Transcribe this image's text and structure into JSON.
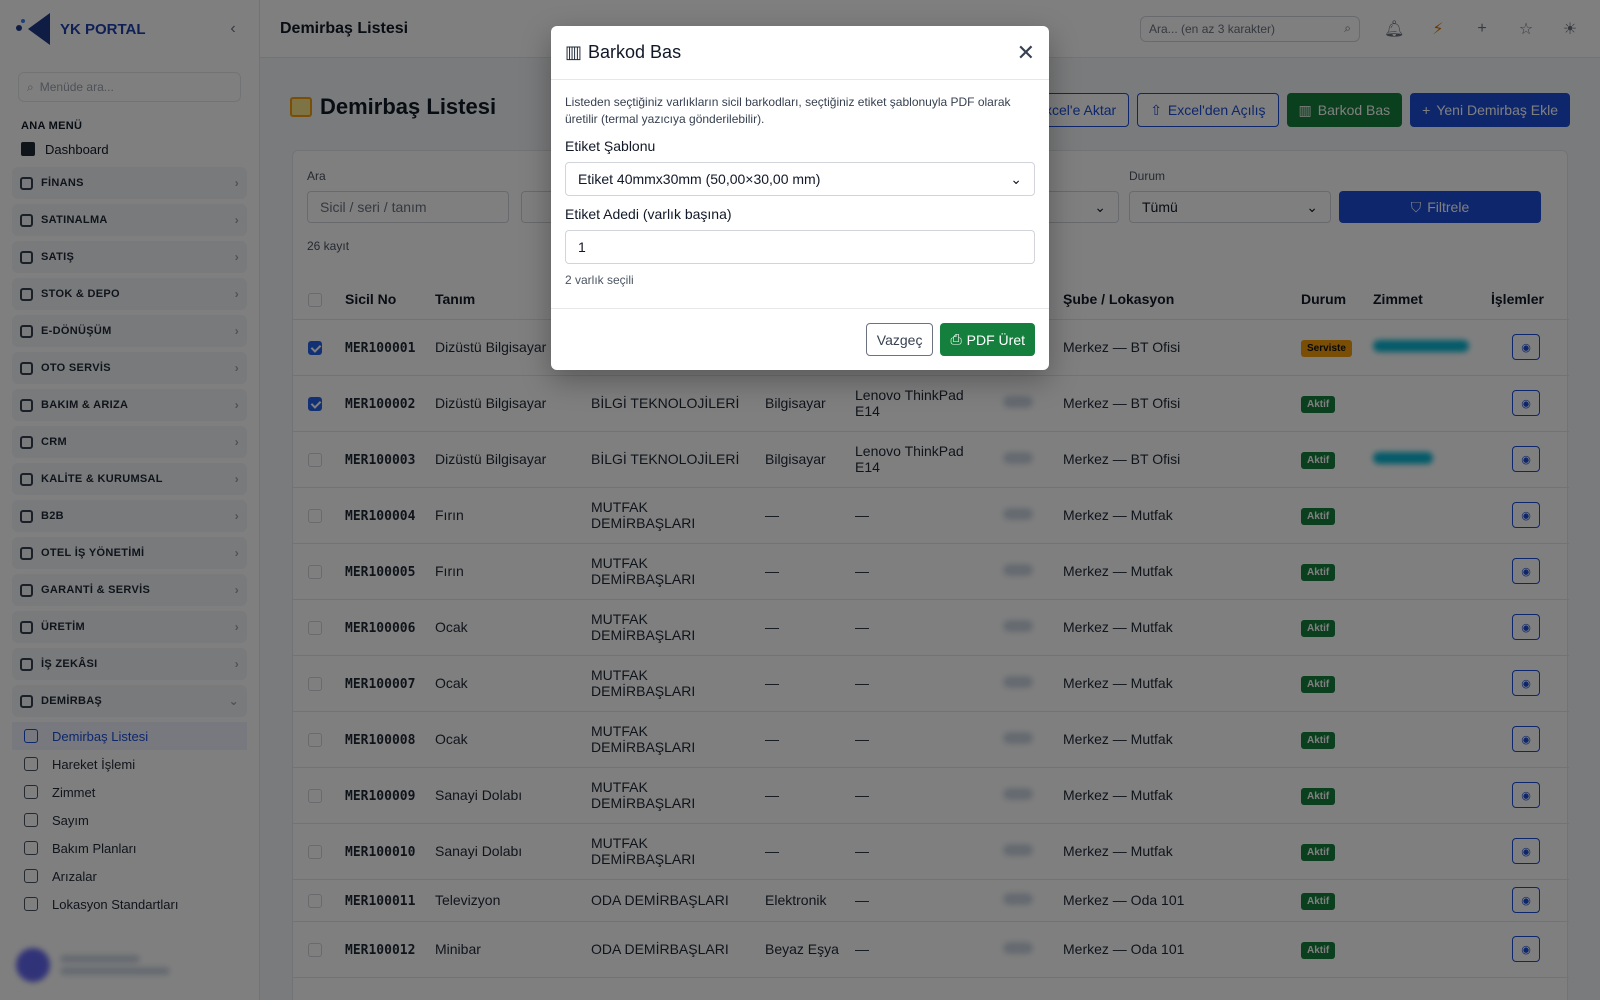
{
  "brand": {
    "name": "YK PORTAL"
  },
  "sidebar": {
    "search_placeholder": "Menüde ara...",
    "section": "ANA MENÜ",
    "dashboard": "Dashboard",
    "groups": [
      "FİNANS",
      "SATINALMA",
      "SATIŞ",
      "STOK & DEPO",
      "E-DÖNÜŞÜM",
      "OTO SERVİS",
      "BAKIM & ARIZA",
      "CRM",
      "KALİTE & KURUMSAL",
      "B2B",
      "OTEL İŞ YÖNETİMİ",
      "GARANTİ & SERVİS",
      "ÜRETİM",
      "İŞ ZEKÂSI",
      "DEMİRBAŞ"
    ],
    "sub_items": [
      "Demirbaş Listesi",
      "Hareket İşlemi",
      "Zimmet",
      "Sayım",
      "Bakım Planları",
      "Arızalar",
      "Lokasyon Standartları"
    ]
  },
  "topbar": {
    "title": "Demirbaş Listesi",
    "search_placeholder": "Ara... (en az 3 karakter)"
  },
  "page": {
    "title": "Demirbaş Listesi"
  },
  "actions": {
    "export": "Excel'e Aktar",
    "import": "Excel'den Açılış",
    "barcode": "Barkod Bas",
    "add": "Yeni Demirbaş Ekle"
  },
  "filters": {
    "search_label": "Ara",
    "search_placeholder": "Sicil / seri / tanım",
    "status_label": "Durum",
    "status_value": "Tümü",
    "filter_button": "Filtrele"
  },
  "record_count": "26 kayıt",
  "table": {
    "headers": {
      "sicil": "Sicil No",
      "tanim": "Tanım",
      "sube": "Şube / Lokasyon",
      "durum": "Durum",
      "zimmet": "Zimmet",
      "islemler": "İşlemler"
    },
    "rows": [
      {
        "checked": true,
        "sicil": "MER100001",
        "tanim": "Dizüstü Bilgisayar",
        "grup": "",
        "kategori": "",
        "model": "",
        "sube": "Merkez — BT Ofisi",
        "durum": "Serviste",
        "zimmet": true,
        "tall": true
      },
      {
        "checked": true,
        "sicil": "MER100002",
        "tanim": "Dizüstü Bilgisayar",
        "grup": "BİLGİ TEKNOLOJİLERİ",
        "kategori": "Bilgisayar",
        "model": "Lenovo ThinkPad E14",
        "sube": "Merkez — BT Ofisi",
        "durum": "Aktif",
        "zimmet": false,
        "tall": true
      },
      {
        "checked": false,
        "sicil": "MER100003",
        "tanim": "Dizüstü Bilgisayar",
        "grup": "BİLGİ TEKNOLOJİLERİ",
        "kategori": "Bilgisayar",
        "model": "Lenovo ThinkPad E14",
        "sube": "Merkez — BT Ofisi",
        "durum": "Aktif",
        "zimmet": true,
        "tall": true
      },
      {
        "checked": false,
        "sicil": "MER100004",
        "tanim": "Fırın",
        "grup": "MUTFAK DEMİRBAŞLARI",
        "kategori": "—",
        "model": "—",
        "sube": "Merkez — Mutfak",
        "durum": "Aktif",
        "zimmet": false,
        "tall": true
      },
      {
        "checked": false,
        "sicil": "MER100005",
        "tanim": "Fırın",
        "grup": "MUTFAK DEMİRBAŞLARI",
        "kategori": "—",
        "model": "—",
        "sube": "Merkez — Mutfak",
        "durum": "Aktif",
        "zimmet": false,
        "tall": true
      },
      {
        "checked": false,
        "sicil": "MER100006",
        "tanim": "Ocak",
        "grup": "MUTFAK DEMİRBAŞLARI",
        "kategori": "—",
        "model": "—",
        "sube": "Merkez — Mutfak",
        "durum": "Aktif",
        "zimmet": false,
        "tall": true
      },
      {
        "checked": false,
        "sicil": "MER100007",
        "tanim": "Ocak",
        "grup": "MUTFAK DEMİRBAŞLARI",
        "kategori": "—",
        "model": "—",
        "sube": "Merkez — Mutfak",
        "durum": "Aktif",
        "zimmet": false,
        "tall": true
      },
      {
        "checked": false,
        "sicil": "MER100008",
        "tanim": "Ocak",
        "grup": "MUTFAK DEMİRBAŞLARI",
        "kategori": "—",
        "model": "—",
        "sube": "Merkez — Mutfak",
        "durum": "Aktif",
        "zimmet": false,
        "tall": true
      },
      {
        "checked": false,
        "sicil": "MER100009",
        "tanim": "Sanayi Dolabı",
        "grup": "MUTFAK DEMİRBAŞLARI",
        "kategori": "—",
        "model": "—",
        "sube": "Merkez — Mutfak",
        "durum": "Aktif",
        "zimmet": false,
        "tall": true
      },
      {
        "checked": false,
        "sicil": "MER100010",
        "tanim": "Sanayi Dolabı",
        "grup": "MUTFAK DEMİRBAŞLARI",
        "kategori": "—",
        "model": "—",
        "sube": "Merkez — Mutfak",
        "durum": "Aktif",
        "zimmet": false,
        "tall": true
      },
      {
        "checked": false,
        "sicil": "MER100011",
        "tanim": "Televizyon",
        "grup": "ODA DEMİRBAŞLARI",
        "kategori": "Elektronik",
        "model": "—",
        "sube": "Merkez — Oda 101",
        "durum": "Aktif",
        "zimmet": false,
        "tall": false
      },
      {
        "checked": false,
        "sicil": "MER100012",
        "tanim": "Minibar",
        "grup": "ODA DEMİRBAŞLARI",
        "kategori": "Beyaz Eşya",
        "model": "—",
        "sube": "Merkez — Oda 101",
        "durum": "Aktif",
        "zimmet": false,
        "tall": true
      }
    ]
  },
  "modal": {
    "title": "Barkod Bas",
    "description": "Listeden seçtiğiniz varlıkların sicil barkodları, seçtiğiniz etiket şablonuyla PDF olarak üretilir (termal yazıcıya gönderilebilir).",
    "template_label": "Etiket Şablonu",
    "template_value": "Etiket 40mmx30mm (50,00×30,00 mm)",
    "qty_label": "Etiket Adedi (varlık başına)",
    "qty_value": "1",
    "selected_hint": "2 varlık seçili",
    "cancel": "Vazgeç",
    "pdf": "PDF Üret"
  },
  "colors": {
    "primary": "#1d4ed8",
    "success": "#15803d",
    "warning": "#f59e0b"
  }
}
